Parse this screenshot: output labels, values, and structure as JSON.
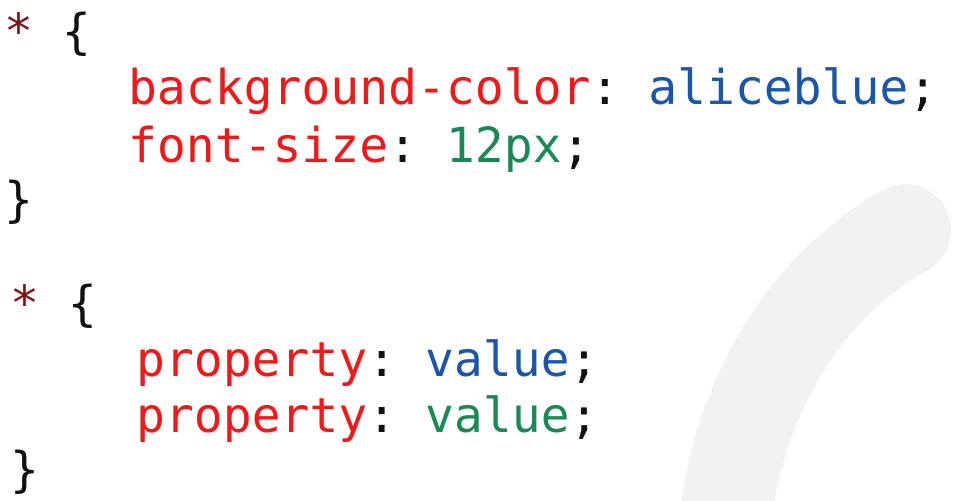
{
  "rules": [
    {
      "selector": "*",
      "open_brace": "{",
      "close_brace": "}",
      "declarations": [
        {
          "property": "background-color",
          "colon": ":",
          "value": "aliceblue",
          "semicolon": ";"
        },
        {
          "property": "font-size",
          "colon": ":",
          "value": "12px",
          "semicolon": ";"
        }
      ]
    },
    {
      "selector": "*",
      "open_brace": "{",
      "close_brace": "}",
      "declarations": [
        {
          "property": "property",
          "colon": ":",
          "value": "value",
          "semicolon": ";"
        },
        {
          "property": "property",
          "colon": ":",
          "value": "value",
          "semicolon": ";"
        }
      ]
    }
  ],
  "colors": {
    "selector": "#7a1616",
    "property": "#f01818",
    "value_keyword": "#1b57a8",
    "value_number": "#1a8a55",
    "punctuation": "#111111",
    "background": "#ffffff",
    "decor_arc": "#f2f2f2"
  }
}
